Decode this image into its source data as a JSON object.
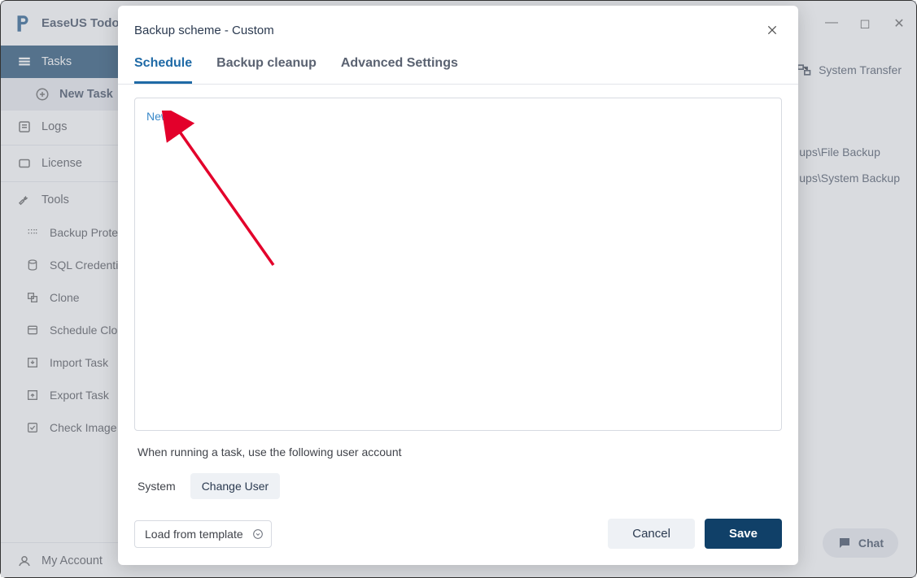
{
  "app": {
    "title": "EaseUS Todo",
    "window_controls": {
      "min": "—",
      "max": "◻",
      "close": "✕"
    }
  },
  "sidebar": {
    "tasks": "Tasks",
    "new_task": "New Task",
    "logs": "Logs",
    "license": "License",
    "tools": "Tools",
    "backup_protection": "Backup Protection",
    "sql_credential": "SQL Credential Manager",
    "clone": "Clone",
    "schedule_clone": "Schedule Clone",
    "import_task": "Import Task",
    "export_task": "Export Task",
    "check_image": "Check Image",
    "my_account": "My Account"
  },
  "topbar": {
    "system_transfer": "System Transfer"
  },
  "paths": {
    "p1": "…ups\\File Backup",
    "p2": "…ups\\System Backup"
  },
  "chat": {
    "label": "Chat"
  },
  "modal": {
    "title": "Backup scheme - Custom",
    "tabs": {
      "schedule": "Schedule",
      "cleanup": "Backup cleanup",
      "advanced": "Advanced Settings"
    },
    "new_link": "New…",
    "user_hint": "When running a task, use the following user account",
    "user_label": "System",
    "change_user": "Change User",
    "template_label": "Load from template",
    "cancel": "Cancel",
    "save": "Save"
  }
}
